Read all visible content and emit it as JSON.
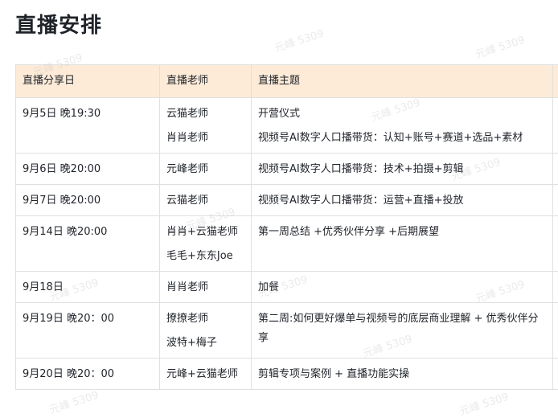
{
  "title": "直播安排",
  "table": {
    "headers": [
      "直播分享日",
      "直播老师",
      "直播主题"
    ],
    "rows": [
      {
        "date": "9月5日 晚19:30",
        "teachers": [
          "云猫老师",
          "肖肖老师"
        ],
        "topics": [
          "开营仪式",
          "视频号AI数字人口播带货：认知+账号+赛道+选品+素材"
        ]
      },
      {
        "date": "9月6日 晚20:00",
        "teachers": [
          "元峰老师"
        ],
        "topics": [
          "视频号AI数字人口播带货：技术+拍摄+剪辑"
        ]
      },
      {
        "date": "9月7日 晚20:00",
        "teachers": [
          "云猫老师"
        ],
        "topics": [
          "视频号AI数字人口播带货：运营+直播+投放"
        ]
      },
      {
        "date": "9月14日 晚20:00",
        "teachers": [
          "肖肖+云猫老师",
          "毛毛+东东Joe"
        ],
        "topics": [
          "第一周总结 +优秀伙伴分享 +后期展望"
        ]
      },
      {
        "date": "9月18日",
        "teachers": [
          "肖肖老师"
        ],
        "topics": [
          "加餐"
        ]
      },
      {
        "date": "9月19日 晚20：00",
        "teachers": [
          "撩撩老师",
          "波特+梅子"
        ],
        "topics": [
          "第二周:如何更好爆单与视频号的底层商业理解 + 优秀伙伴分享"
        ]
      },
      {
        "date": "9月20日 晚20：00",
        "teachers": [
          "元峰+云猫老师"
        ],
        "topics": [
          "剪辑专项与案例 + 直播功能实操"
        ]
      }
    ]
  },
  "watermark": "元峰 5309"
}
